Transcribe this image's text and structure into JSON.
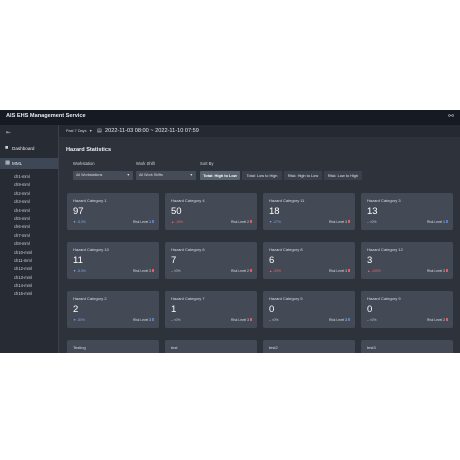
{
  "app": {
    "title": "AIS EHS Management Service",
    "user_icon": "user-icon"
  },
  "sidebar": {
    "collapse_icon": "sidebar-collapse-icon",
    "items": [
      {
        "label": "Dashboard",
        "icon": "dashboard-icon"
      },
      {
        "label": "MML",
        "icon": "building-icon"
      }
    ],
    "stations": [
      "ch1-mml",
      "ch9-mml",
      "ch2-mml",
      "ch3-mml",
      "ch4-mml",
      "ch5-mml",
      "ch6-mml",
      "ch7-mml",
      "ch8-mml",
      "ch10-mml",
      "ch11-mml",
      "ch12-mml",
      "ch13-mml",
      "ch14-mml",
      "ch15-mml"
    ]
  },
  "topbar": {
    "range_label": "Past 7 Days",
    "date_range": "2022-11-03 08:00 ~ 2022-11-10 07:59"
  },
  "stats": {
    "title": "Hazard Statistics",
    "filters": {
      "workstation": {
        "label": "Workstation",
        "value": "All Workstations"
      },
      "work_shift": {
        "label": "Work Shift",
        "value": "All Work Shifts"
      },
      "sort_by": {
        "label": "Sort By",
        "options": [
          "Total: High to Low",
          "Total: Low to High",
          "Risk: High to Low",
          "Risk: Low to High"
        ],
        "selected": "Total: High to Low"
      }
    },
    "cards": [
      {
        "title": "Hazard Category 1",
        "value": "97",
        "change": "-8.3%",
        "dir": "down",
        "risk": "Risk Level 1",
        "risk_color": "#4c7fd8"
      },
      {
        "title": "Hazard Category 4",
        "value": "50",
        "change": "-15%",
        "dir": "up",
        "risk": "Risk Level 2",
        "risk_color": "#e35d5d"
      },
      {
        "title": "Hazard Category 11",
        "value": "18",
        "change": "-27%",
        "dir": "down",
        "risk": "Risk Level 3",
        "risk_color": "#e35d5d"
      },
      {
        "title": "Hazard Category 3",
        "value": "13",
        "change": "<0%",
        "dir": "neutral",
        "risk": "Risk Level 1",
        "risk_color": "#4c7fd8"
      },
      {
        "title": "Hazard Category 10",
        "value": "11",
        "change": "-8.3%",
        "dir": "down",
        "risk": "Risk Level 3",
        "risk_color": "#e35d5d"
      },
      {
        "title": "Hazard Category 6",
        "value": "7",
        "change": "<0%",
        "dir": "neutral",
        "risk": "Risk Level 2",
        "risk_color": "#e35d5d"
      },
      {
        "title": "Hazard Category 8",
        "value": "6",
        "change": "-33%",
        "dir": "up",
        "risk": "Risk Level 3",
        "risk_color": "#e35d5d"
      },
      {
        "title": "Hazard Category 12",
        "value": "3",
        "change": "-100%",
        "dir": "up",
        "risk": "Risk Level 3",
        "risk_color": "#e35d5d"
      },
      {
        "title": "Hazard Category 2",
        "value": "2",
        "change": "-80%",
        "dir": "down",
        "risk": "Risk Level 3",
        "risk_color": "#4c7fd8"
      },
      {
        "title": "Hazard Category 7",
        "value": "1",
        "change": "<0%",
        "dir": "neutral",
        "risk": "Risk Level 3",
        "risk_color": "#e35d5d"
      },
      {
        "title": "Hazard Category 5",
        "value": "0",
        "change": "<0%",
        "dir": "neutral",
        "risk": "Risk Level 3",
        "risk_color": "#4c7fd8"
      },
      {
        "title": "Hazard Category 9",
        "value": "0",
        "change": "<0%",
        "dir": "neutral",
        "risk": "Risk Level 2",
        "risk_color": "#e35d5d"
      },
      {
        "title": "Testing",
        "value": "0",
        "change": "",
        "dir": "neutral",
        "risk": "",
        "risk_color": "#4c7fd8"
      },
      {
        "title": "test",
        "value": "0",
        "change": "",
        "dir": "neutral",
        "risk": "",
        "risk_color": "#4c7fd8"
      },
      {
        "title": "test2",
        "value": "0",
        "change": "",
        "dir": "neutral",
        "risk": "",
        "risk_color": "#4c7fd8"
      },
      {
        "title": "test3",
        "value": "0",
        "change": "",
        "dir": "neutral",
        "risk": "",
        "risk_color": "#4c7fd8"
      }
    ]
  }
}
